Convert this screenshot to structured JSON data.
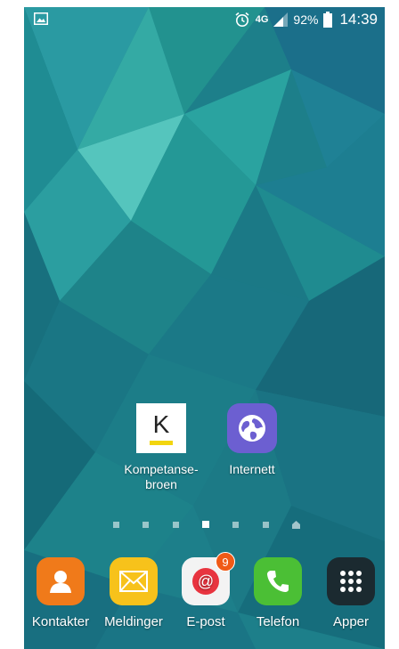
{
  "status_bar": {
    "network": "4G",
    "battery": "92%",
    "time": "14:39"
  },
  "home_apps": [
    {
      "label": "Kompetanse-broen",
      "label_line1": "Kompetanse-",
      "label_line2": "broen",
      "icon_letter": "K"
    },
    {
      "label": "Internett"
    }
  ],
  "page_indicator": {
    "count": 7,
    "active_index": 3
  },
  "dock": [
    {
      "label": "Kontakter",
      "color": "#f07a1a"
    },
    {
      "label": "Meldinger",
      "color": "#f7c21b"
    },
    {
      "label": "E-post",
      "color": "#f3f3f3",
      "badge": "9"
    },
    {
      "label": "Telefon",
      "color": "#4bbf35"
    },
    {
      "label": "Apper",
      "color": "#1b2a30"
    }
  ]
}
